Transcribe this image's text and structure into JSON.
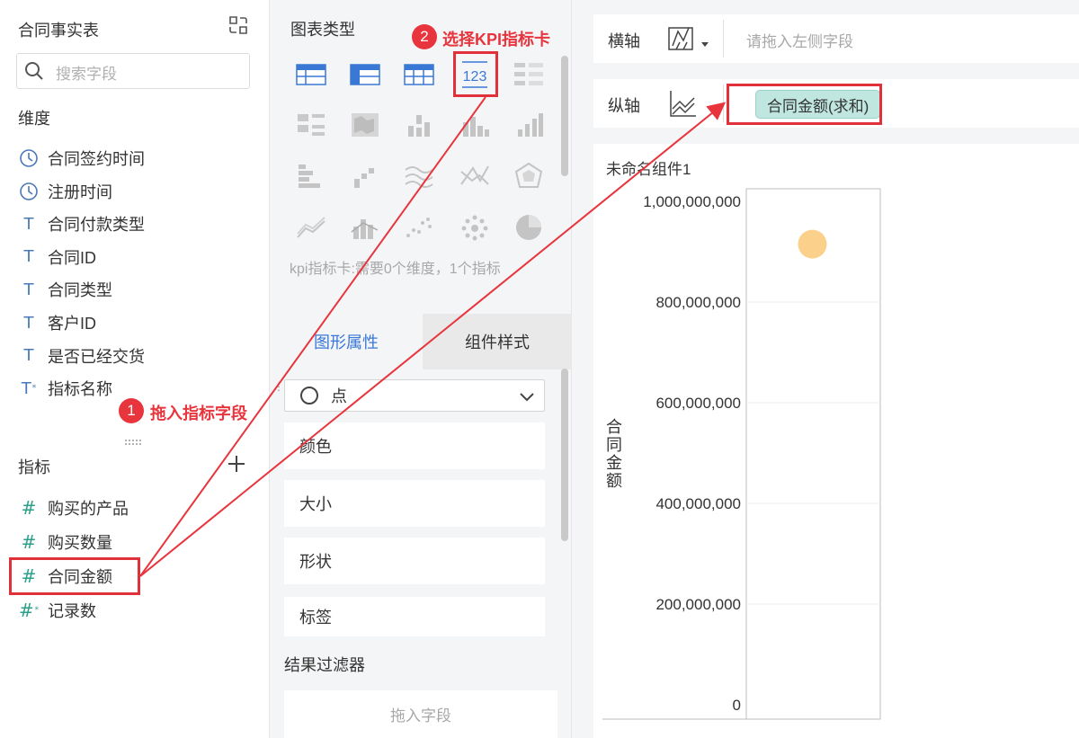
{
  "left": {
    "title": "合同事实表",
    "search_placeholder": "搜索字段",
    "dimension_label": "维度",
    "dimensions": [
      {
        "label": "合同签约时间",
        "icon": "clock-icon"
      },
      {
        "label": "注册时间",
        "icon": "clock-icon"
      },
      {
        "label": "合同付款类型",
        "icon": "text-type-icon"
      },
      {
        "label": "合同ID",
        "icon": "text-type-icon"
      },
      {
        "label": "合同类型",
        "icon": "text-type-icon"
      },
      {
        "label": "客户ID",
        "icon": "text-type-icon"
      },
      {
        "label": "是否已经交货",
        "icon": "text-type-icon"
      },
      {
        "label": "指标名称",
        "icon": "text-calc-type-icon"
      }
    ],
    "metric_label": "指标",
    "metrics": [
      {
        "label": "购买的产品",
        "icon": "number-type-icon"
      },
      {
        "label": "购买数量",
        "icon": "number-type-icon"
      },
      {
        "label": "合同金额",
        "icon": "number-type-icon"
      },
      {
        "label": "记录数",
        "icon": "number-calc-type-icon"
      }
    ]
  },
  "annotations": {
    "step1_number": "1",
    "step1_text": "拖入指标字段",
    "step2_number": "2",
    "step2_text": "选择KPI指标卡",
    "color": "#e8343c"
  },
  "middle": {
    "chart_type_label": "图表类型",
    "kpi_icon_text": "123",
    "kpi_hint": "kpi指标卡:需要0个维度，1个指标",
    "tabs": [
      "图形属性",
      "组件样式"
    ],
    "shape_select": "点",
    "props": [
      "颜色",
      "大小",
      "形状",
      "标签"
    ],
    "filter_label": "结果过滤器",
    "filter_drop": "拖入字段",
    "accent": "#3a78d6"
  },
  "right": {
    "x_axis_label": "横轴",
    "x_axis_placeholder": "请拖入左侧字段",
    "y_axis_label": "纵轴",
    "y_axis_field": "合同金额(求和)",
    "widget_title": "未命名组件1",
    "y_title": "合同金额"
  },
  "chart_data": {
    "type": "scatter",
    "ylabel": "合同金额",
    "xlabel": "",
    "ylim": [
      0,
      1000000000
    ],
    "yticks": [
      "1,000,000,000",
      "800,000,000",
      "600,000,000",
      "400,000,000",
      "200,000,000",
      "0"
    ],
    "points": [
      {
        "y": 915000000
      }
    ],
    "point_color": "#fbd08a"
  }
}
